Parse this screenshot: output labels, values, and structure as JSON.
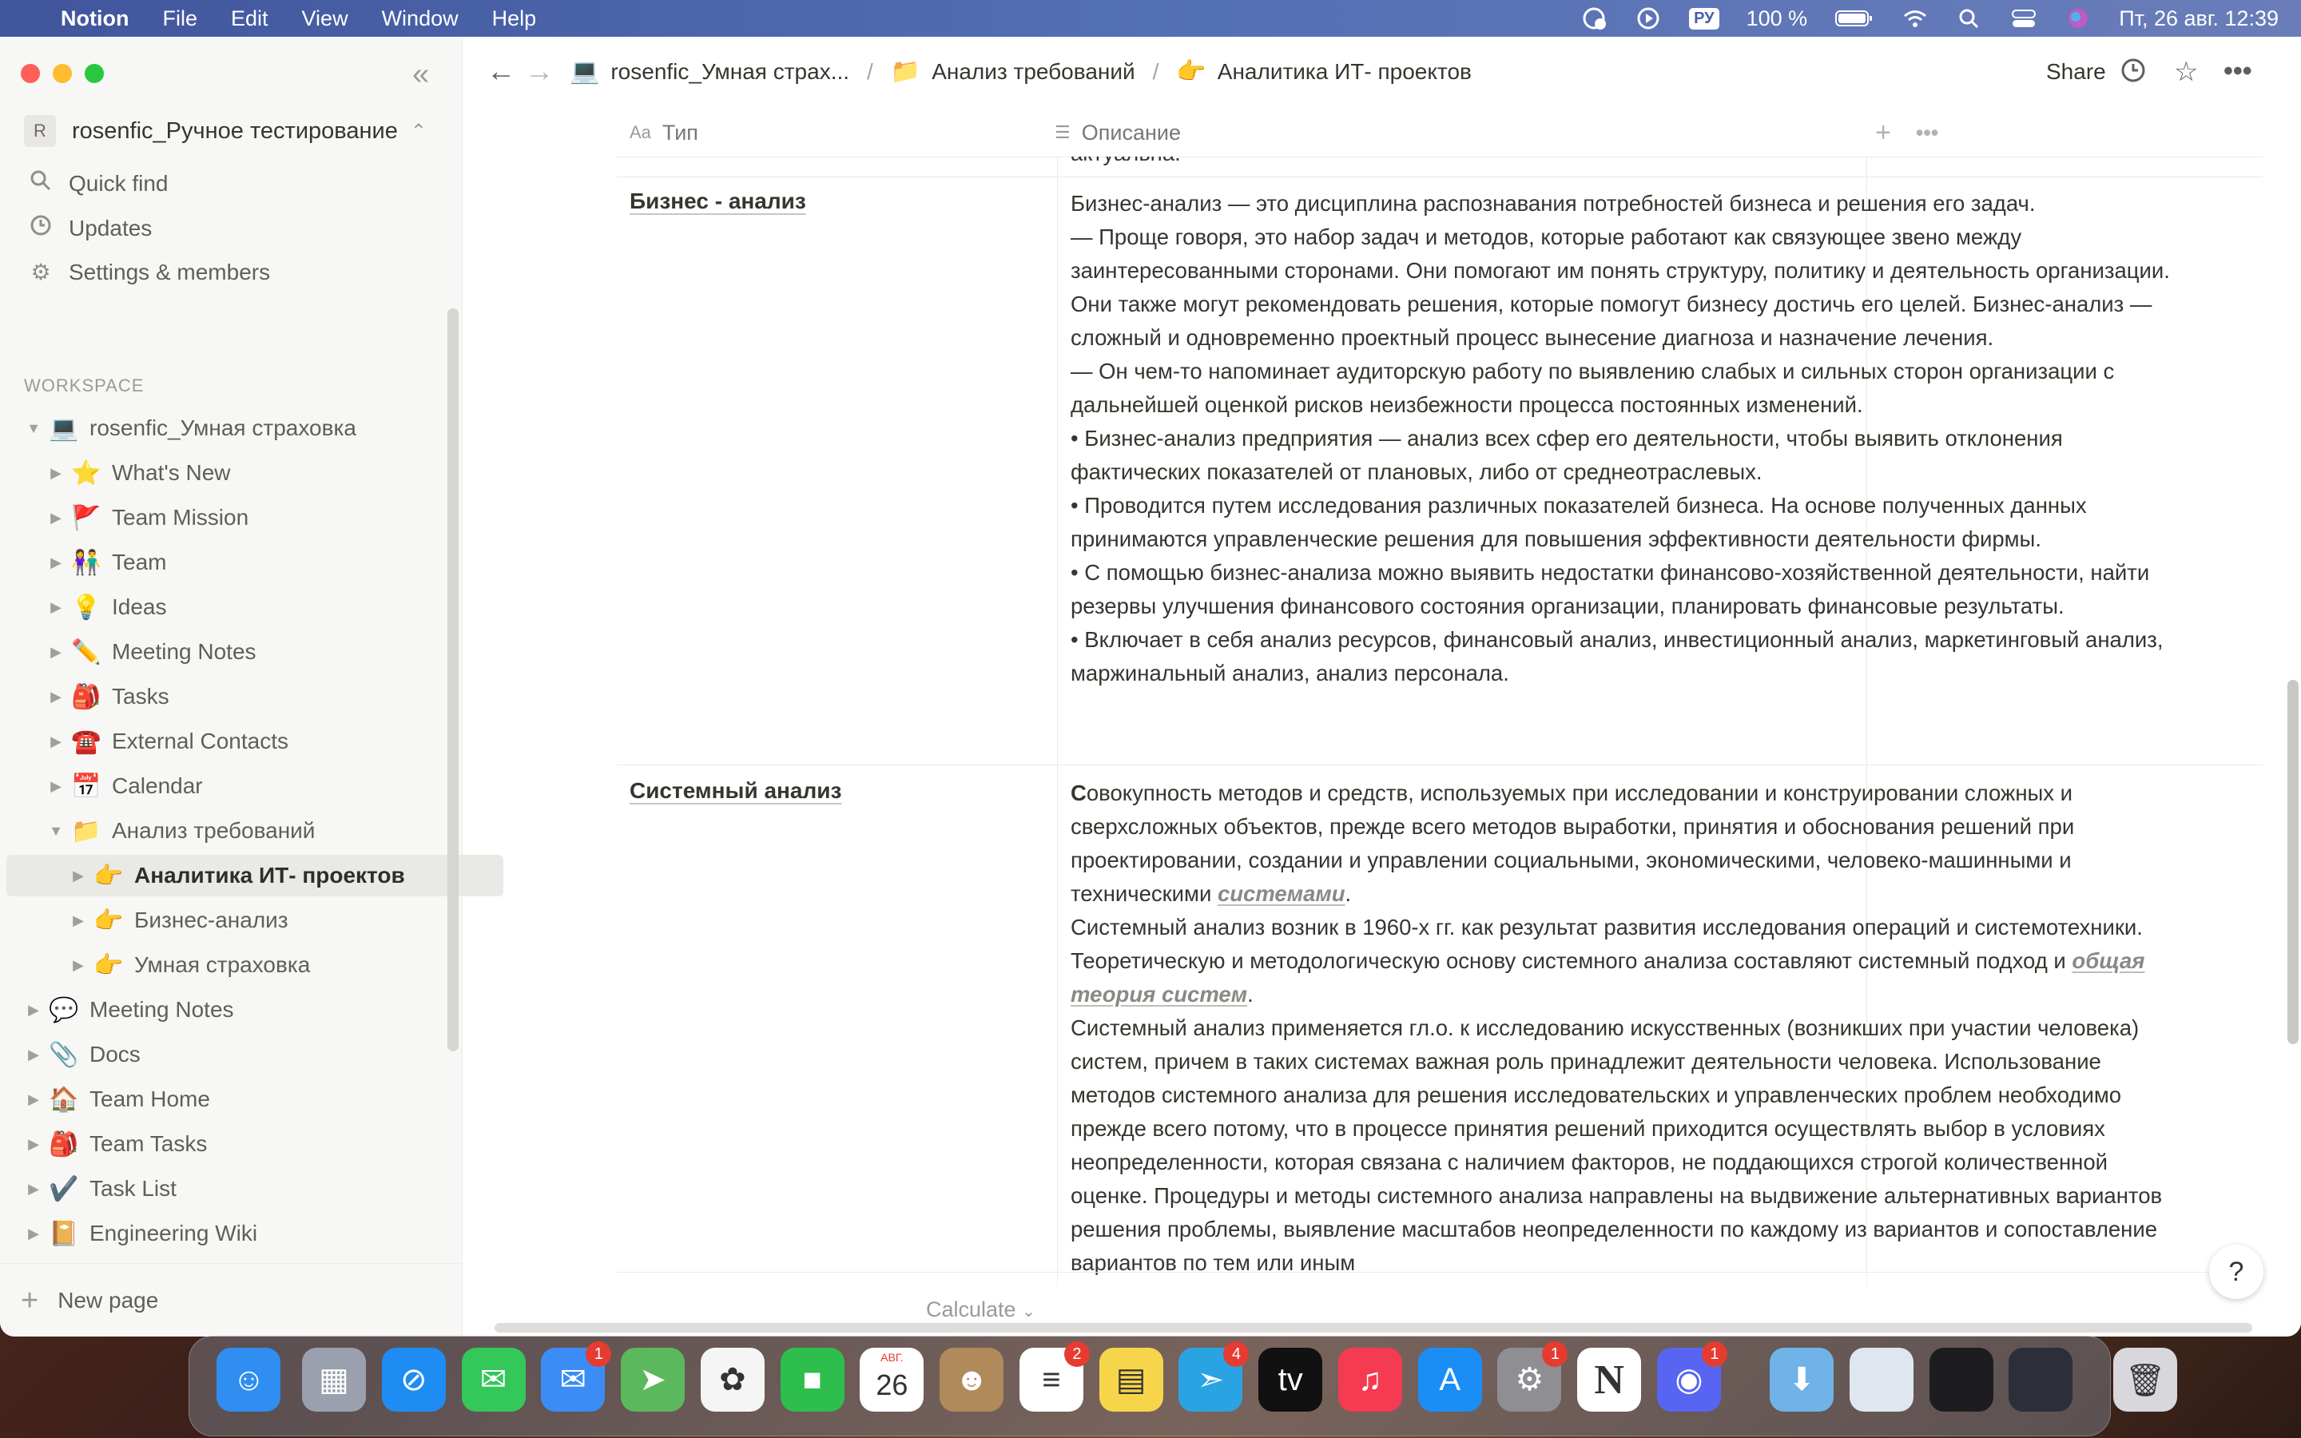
{
  "menubar": {
    "app": "Notion",
    "items": [
      "File",
      "Edit",
      "View",
      "Window",
      "Help"
    ],
    "battery": "100 %",
    "input_lang": "РУ",
    "datetime": "Пт, 26 авг.  12:39"
  },
  "sidebar": {
    "workspace_name": "rosenfic_Ручное тестирование",
    "workspace_initial": "R",
    "quick_find": "Quick find",
    "updates": "Updates",
    "settings": "Settings & members",
    "section_heading": "WORKSPACE",
    "items": [
      {
        "label": "rosenfic_Умная страховка",
        "emoji": "💻",
        "toggle": "▼"
      },
      {
        "label": "What's New",
        "emoji": "⭐",
        "toggle": "▶"
      },
      {
        "label": "Team Mission",
        "emoji": "🚩",
        "toggle": "▶"
      },
      {
        "label": "Team",
        "emoji": "👫",
        "toggle": "▶"
      },
      {
        "label": "Ideas",
        "emoji": "💡",
        "toggle": "▶"
      },
      {
        "label": "Meeting Notes",
        "emoji": "✏️",
        "toggle": "▶"
      },
      {
        "label": "Tasks",
        "emoji": "🎒",
        "toggle": "▶"
      },
      {
        "label": "External Contacts",
        "emoji": "☎️",
        "toggle": "▶"
      },
      {
        "label": "Calendar",
        "emoji": "📅",
        "toggle": "▶"
      },
      {
        "label": "Анализ требований",
        "emoji": "📁",
        "toggle": "▼"
      },
      {
        "label": "Аналитика ИТ- проектов",
        "emoji": "👉",
        "toggle": "▶"
      },
      {
        "label": "Бизнес-анализ",
        "emoji": "👉",
        "toggle": "▶"
      },
      {
        "label": "Умная страховка",
        "emoji": "👉",
        "toggle": "▶"
      },
      {
        "label": "Meeting Notes",
        "emoji": "💬",
        "toggle": "▶"
      },
      {
        "label": "Docs",
        "emoji": "📎",
        "toggle": "▶"
      },
      {
        "label": "Team Home",
        "emoji": "🏠",
        "toggle": "▶"
      },
      {
        "label": "Team Tasks",
        "emoji": "🎒",
        "toggle": "▶"
      },
      {
        "label": "Task List",
        "emoji": "✔️",
        "toggle": "▶"
      },
      {
        "label": "Engineering Wiki",
        "emoji": "📔",
        "toggle": "▶"
      }
    ],
    "new_page": "New page"
  },
  "topbar": {
    "crumbs": [
      {
        "emoji": "💻",
        "label": "rosenfic_Умная страх..."
      },
      {
        "emoji": "📁",
        "label": "Анализ требований"
      },
      {
        "emoji": "👉",
        "label": "Аналитика ИТ- проектов"
      }
    ],
    "separator": "/",
    "share": "Share"
  },
  "table": {
    "col_type_icon": "Aa",
    "col_type": "Тип",
    "col_desc": "Описание",
    "partial_text": "актуальна.",
    "rows": [
      {
        "type": "Бизнес - анализ",
        "lines": [
          "Бизнес-анализ — это дисциплина распознавания потребностей бизнеса и решения его задач.",
          "— Проще говоря, это набор задач и методов, которые работают как связующее звено между заинтересованными сторонами. Они помогают им понять структуру, политику и деятельность организации. Они также могут рекомендовать решения, которые помогут бизнесу достичь его целей. Бизнес-анализ  — сложный и одновременно проектный процесс вынесение диагноза и назначение лечения.",
          "— Он чем-то напоминает аудиторскую работу по выявлению слабых и сильных сторон организации с дальнейшей оценкой рисков неизбежности процесса постоянных изменений.",
          "• Бизнес-анализ предприятия — анализ всех сфер его деятельности, чтобы выявить отклонения фактических показателей от плановых, либо от среднеотраслевых.",
          "• Проводится путем исследования различных показателей бизнеса. На основе полученных данных принимаются управленческие решения для повышения эффективности деятельности фирмы.",
          "• С помощью бизнес-анализа можно выявить недостатки финансово-хозяйственной деятельности, найти резервы улучшения финансового состояния организации, планировать финансовые результаты.",
          "• Включает в себя анализ ресурсов, финансовый анализ, инвестиционный анализ, маркетинговый анализ, маржинальный анализ, анализ персонала."
        ]
      },
      {
        "type": "Системный анализ",
        "p1_first": "С",
        "p1_text": "овокупность методов и средств, используемых при исследовании и конструировании сложных и сверхсложных объектов, прежде всего методов выработки, принятия и обоснования решений при проектировании, создании и управлении социальными, экономическими, человеко-машинными и техническими ",
        "p1_link": "системами",
        "p1_end": ".",
        "p2_text": "Системный анализ возник в 1960-х гг. как результат развития исследования операций и системотехники. Теоретическую и методологическую основу системного анализа составляют системный подход и ",
        "p2_link": "общая теория систем",
        "p2_end": ".",
        "p3": "Системный анализ применяется гл.о. к исследованию искусственных (возникших при участии человека) систем, причем в таких системах важная роль принадлежит деятельности человека. Использование методов системного анализа для решения исследовательских и управленческих проблем необходимо прежде всего потому, что в процессе принятия решений приходится осуществлять выбор в условиях неопределенности, которая связана с наличием факторов, не поддающихся строгой количественной оценке. Процедуры и методы системного анализа направлены на выдвижение альтернативных вариантов решения проблемы, выявление масштабов неопределенности по каждому из вариантов и сопоставление вариантов по тем или иным"
      }
    ],
    "calculate": "Calculate"
  },
  "help": "?",
  "dock": {
    "items": [
      {
        "name": "finder",
        "color": "#2f8ef0",
        "glyph": "☺"
      },
      {
        "name": "launchpad",
        "color": "#9aa0ad",
        "glyph": "▦"
      },
      {
        "name": "safari",
        "color": "#1e8cf2",
        "glyph": "⊘"
      },
      {
        "name": "messages",
        "color": "#34c759",
        "glyph": "✉"
      },
      {
        "name": "mail",
        "color": "#3b8df5",
        "glyph": "✉",
        "badge": "1"
      },
      {
        "name": "maps",
        "color": "#5cb85c",
        "glyph": "➤"
      },
      {
        "name": "photos",
        "color": "#f5f5f5",
        "glyph": "✿"
      },
      {
        "name": "facetime",
        "color": "#2dbe4e",
        "glyph": "■"
      },
      {
        "name": "calendar",
        "color": "#ffffff",
        "glyph": "26",
        "sub": "АВГ."
      },
      {
        "name": "contacts",
        "color": "#b08a5a",
        "glyph": "☻"
      },
      {
        "name": "reminders",
        "color": "#ffffff",
        "glyph": "≡",
        "badge": "2"
      },
      {
        "name": "notes",
        "color": "#f7d54a",
        "glyph": "▤"
      },
      {
        "name": "telegram",
        "color": "#2aa3e3",
        "glyph": "➣",
        "badge": "4"
      },
      {
        "name": "apple-tv",
        "color": "#111111",
        "glyph": "tv"
      },
      {
        "name": "music",
        "color": "#f43b52",
        "glyph": "♫"
      },
      {
        "name": "app-store",
        "color": "#1a8ef5",
        "glyph": "A"
      },
      {
        "name": "system-preferences",
        "color": "#8e8e93",
        "glyph": "⚙",
        "badge": "1"
      },
      {
        "name": "notion",
        "color": "#ffffff",
        "glyph": "N"
      },
      {
        "name": "discord",
        "color": "#5865f2",
        "glyph": "◉",
        "badge": "1"
      },
      {
        "name": "downloads",
        "color": "#6fb3e8",
        "glyph": "⬇"
      },
      {
        "name": "window-preview-1",
        "color": "#dfe6f0",
        "glyph": ""
      },
      {
        "name": "window-preview-2",
        "color": "#1d1d1f",
        "glyph": ""
      },
      {
        "name": "window-preview-3",
        "color": "#2c2f3a",
        "glyph": ""
      },
      {
        "name": "trash",
        "color": "#d8d8dc",
        "glyph": "🗑"
      }
    ]
  }
}
